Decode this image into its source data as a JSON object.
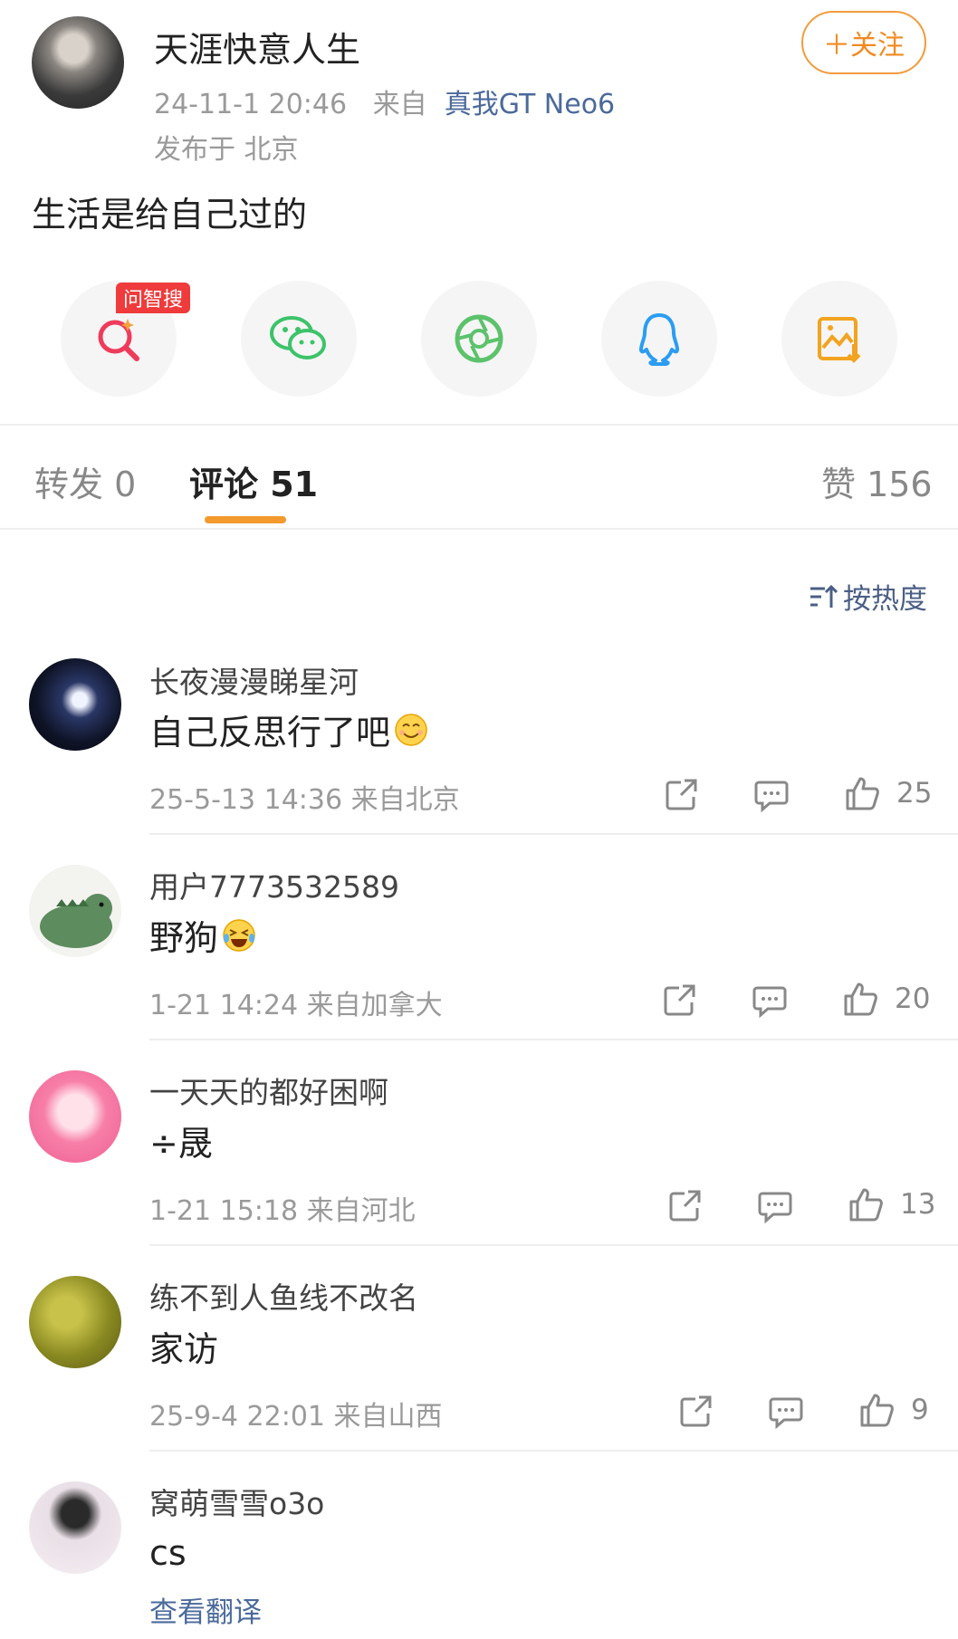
{
  "post": {
    "author": "天涯快意人生",
    "meta_time": "24-11-1 20:46",
    "meta_from": "来自",
    "meta_device": "真我GT Neo6",
    "location": "发布于 北京",
    "follow_label": "＋关注",
    "text": "生活是给自己过的"
  },
  "share": {
    "badge": "问智搜",
    "items": [
      "search-icon",
      "wechat-icon",
      "moments-icon",
      "qq-icon",
      "save-image-icon"
    ]
  },
  "tabs": {
    "repost": "转发 0",
    "comments": "评论 51",
    "likes": "赞 156"
  },
  "sort_label": "按热度",
  "comments": [
    {
      "name": "长夜漫漫睇星河",
      "text": "自己反思行了吧",
      "emoji": "smile",
      "meta": "25-5-13 14:36  来自北京",
      "likes": "25"
    },
    {
      "name": "用户7773532589",
      "text": "野狗",
      "emoji": "laugh-cry",
      "meta": "1-21 14:24  来自加拿大",
      "likes": "20"
    },
    {
      "name": "一天天的都好困啊",
      "text": "÷晟",
      "meta": "1-21 15:18  来自河北",
      "likes": "13"
    },
    {
      "name": "练不到人鱼线不改名",
      "text": "家访",
      "meta": "25-9-4 22:01  来自山西",
      "likes": "9"
    },
    {
      "name": "窝萌雪雪o3o",
      "text": "cs",
      "translate": "查看翻译"
    }
  ],
  "colors": {
    "accent_orange": "#f28a1f",
    "link_blue": "#4b6a9b",
    "badge_red": "#ef3b3b"
  }
}
